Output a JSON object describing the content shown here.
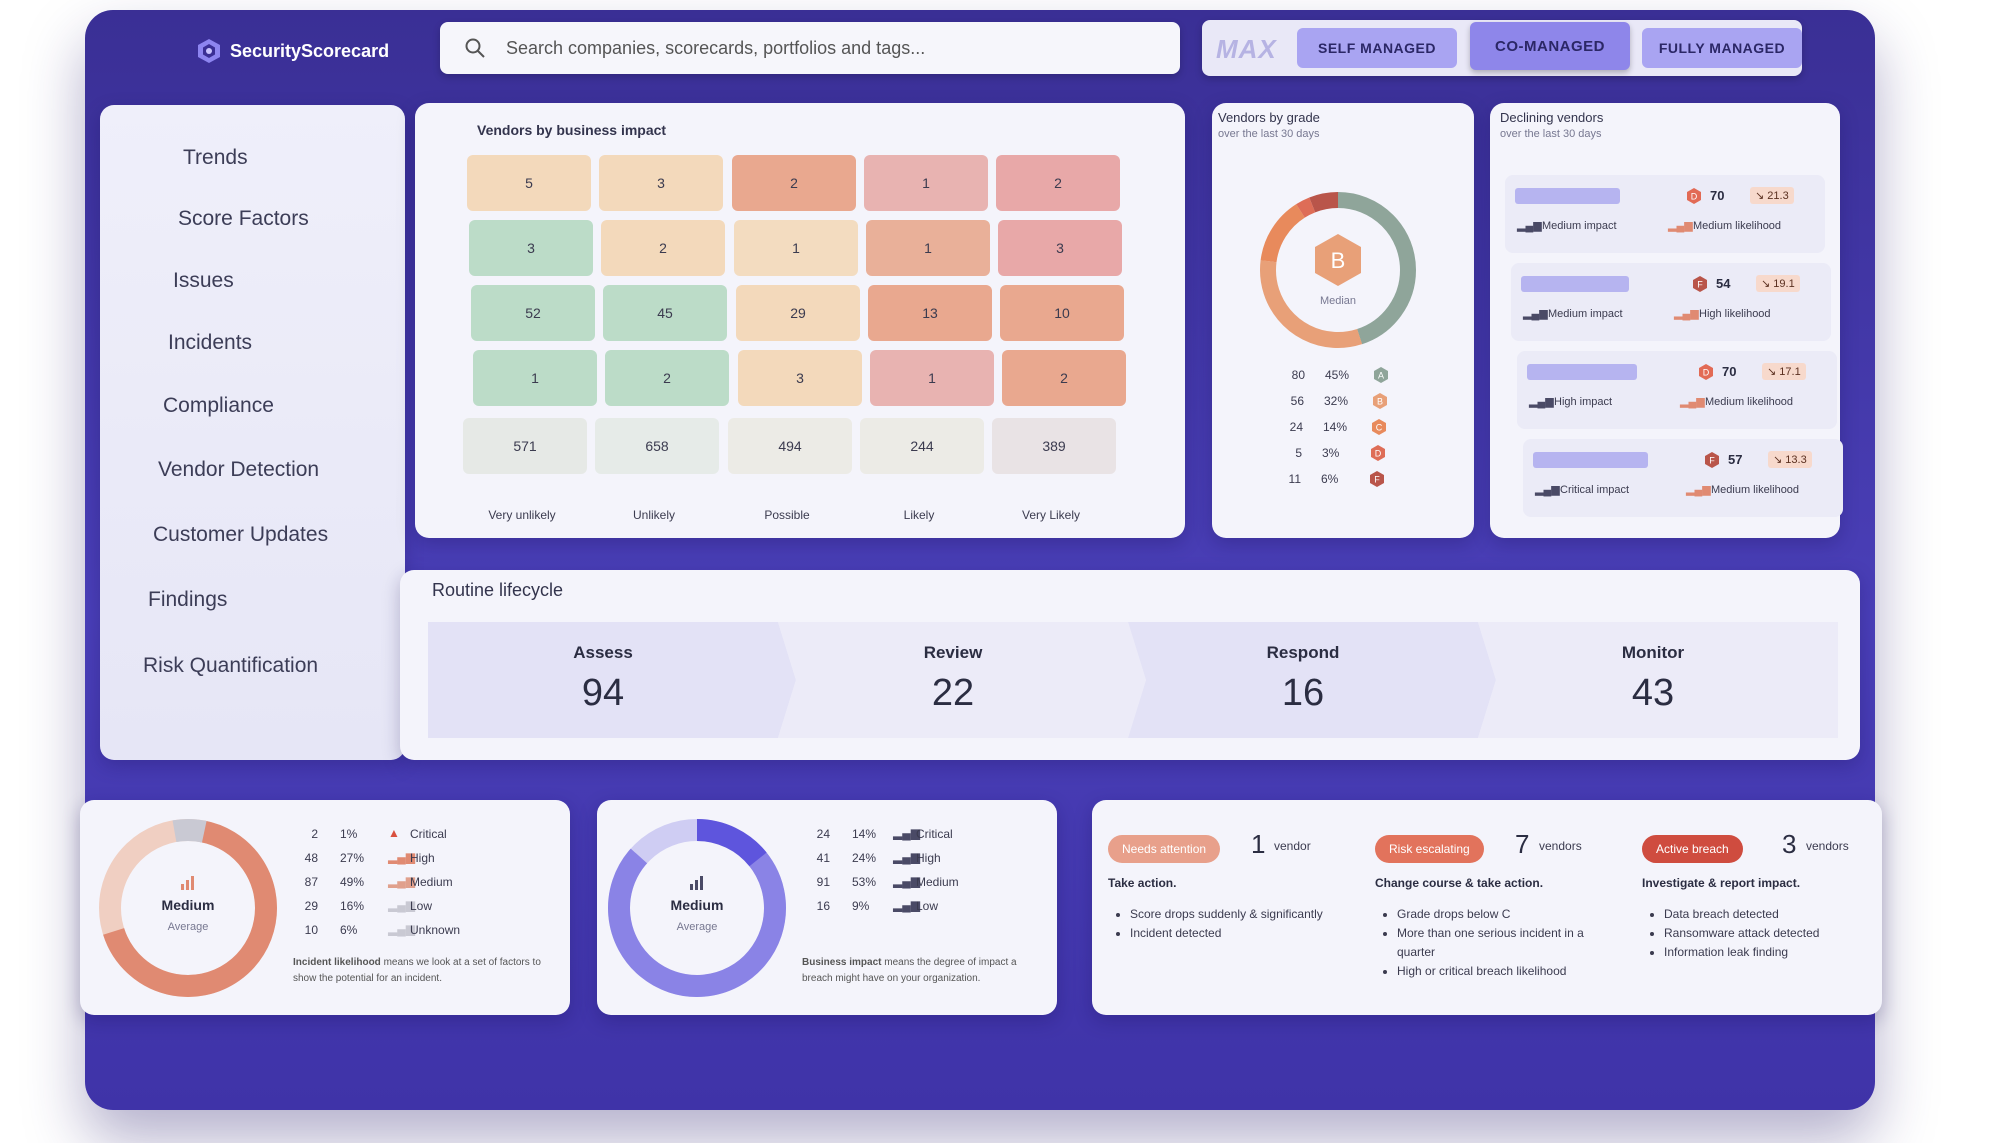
{
  "brand": {
    "name": "SecurityScorecard"
  },
  "search": {
    "placeholder": "Search companies, scorecards, portfolios and tags..."
  },
  "tiers": {
    "logo": "MAX",
    "items": [
      "SELF MANAGED",
      "CO-MANAGED",
      "FULLY MANAGED"
    ],
    "active": "CO-MANAGED"
  },
  "sidebar": {
    "items": [
      "Trends",
      "Score Factors",
      "Issues",
      "Incidents",
      "Compliance",
      "Vendor Detection",
      "Customer Updates",
      "Findings",
      "Risk Quantification"
    ]
  },
  "heatmap": {
    "title": "Vendors by business impact",
    "rows": [
      [
        "5",
        "3",
        "2",
        "1",
        "2"
      ],
      [
        "3",
        "2",
        "1",
        "1",
        "3"
      ],
      [
        "52",
        "45",
        "29",
        "13",
        "10"
      ],
      [
        "1",
        "2",
        "3",
        "1",
        "2"
      ]
    ],
    "colors": [
      [
        "#f3d9bb",
        "#f3d9bb",
        "#e9a88f",
        "#e8b3b1",
        "#e8a8a8"
      ],
      [
        "#bcdcc8",
        "#f3d9bb",
        "#f3dcc0",
        "#e9b099",
        "#e8a8a8"
      ],
      [
        "#bcdcc8",
        "#bcdcc8",
        "#f3d9bb",
        "#e9a88f",
        "#e9a88f"
      ],
      [
        "#bcdcc8",
        "#bcdcc8",
        "#f3d9bb",
        "#e8b3b1",
        "#e9a88f"
      ]
    ],
    "totals": [
      "571",
      "658",
      "494",
      "244",
      "389"
    ],
    "total_colors": [
      "#e6e9e6",
      "#e6ebe8",
      "#ecebe6",
      "#ecebe6",
      "#e9e3e5"
    ],
    "columns": [
      "Very unlikely",
      "Unlikely",
      "Possible",
      "Likely",
      "Very Likely"
    ]
  },
  "grade": {
    "title": "Vendors by grade",
    "subtitle": "over the last 30 days",
    "median_grade": "B",
    "median_label": "Median",
    "rows": [
      {
        "count": "80",
        "pct": "45%",
        "grade": "A",
        "color": "#8fa59a"
      },
      {
        "count": "56",
        "pct": "32%",
        "grade": "B",
        "color": "#e8a078"
      },
      {
        "count": "24",
        "pct": "14%",
        "grade": "C",
        "color": "#e88a5c"
      },
      {
        "count": "5",
        "pct": "3%",
        "grade": "D",
        "color": "#de6d57"
      },
      {
        "count": "11",
        "pct": "6%",
        "grade": "F",
        "color": "#b9554a"
      }
    ],
    "ring_share": [
      45,
      32,
      14,
      3,
      6
    ]
  },
  "declining": {
    "title": "Declining vendors",
    "subtitle": "over the last 30 days",
    "items": [
      {
        "grade": "D",
        "score": "70",
        "delta": "↘ 21.3",
        "impact": "Medium impact",
        "likelihood": "Medium likelihood",
        "grade_color": "#e26a55"
      },
      {
        "grade": "F",
        "score": "54",
        "delta": "↘ 19.1",
        "impact": "Medium impact",
        "likelihood": "High likelihood",
        "grade_color": "#b9554a"
      },
      {
        "grade": "D",
        "score": "70",
        "delta": "↘ 17.1",
        "impact": "High impact",
        "likelihood": "Medium likelihood",
        "grade_color": "#e26a55"
      },
      {
        "grade": "F",
        "score": "57",
        "delta": "↘ 13.3",
        "impact": "Critical impact",
        "likelihood": "Medium likelihood",
        "grade_color": "#b9554a"
      }
    ]
  },
  "lifecycle": {
    "title": "Routine lifecycle",
    "stages": [
      {
        "label": "Assess",
        "value": "94"
      },
      {
        "label": "Review",
        "value": "22"
      },
      {
        "label": "Respond",
        "value": "16"
      },
      {
        "label": "Monitor",
        "value": "43"
      }
    ]
  },
  "likelihood": {
    "center_label": "Medium",
    "center_sub": "Average",
    "rows": [
      {
        "count": "2",
        "pct": "1%",
        "label": "Critical"
      },
      {
        "count": "48",
        "pct": "27%",
        "label": "High"
      },
      {
        "count": "87",
        "pct": "49%",
        "label": "Medium"
      },
      {
        "count": "29",
        "pct": "16%",
        "label": "Low"
      },
      {
        "count": "10",
        "pct": "6%",
        "label": "Unknown"
      }
    ],
    "note_bold": "Incident likelihood",
    "note": "means we look at a set of factors to show the potential for an incident."
  },
  "impact": {
    "center_label": "Medium",
    "center_sub": "Average",
    "rows": [
      {
        "count": "24",
        "pct": "14%",
        "label": "Critical"
      },
      {
        "count": "41",
        "pct": "24%",
        "label": "High"
      },
      {
        "count": "91",
        "pct": "53%",
        "label": "Medium"
      },
      {
        "count": "16",
        "pct": "9%",
        "label": "Low"
      }
    ],
    "note_bold": "Business impact",
    "note": "means the degree of impact a breach might have on your organization."
  },
  "status": [
    {
      "pill": "Needs attention",
      "pill_color": "#e8a08b",
      "count": "1",
      "unit": "vendor",
      "head": "Take action.",
      "bullets": [
        "Score drops suddenly & significantly",
        "Incident detected"
      ]
    },
    {
      "pill": "Risk escalating",
      "pill_color": "#e2735c",
      "count": "7",
      "unit": "vendors",
      "head": "Change course & take action.",
      "bullets": [
        "Grade drops below C",
        "More than one serious incident in a quarter",
        "High or critical breach likelihood"
      ]
    },
    {
      "pill": "Active breach",
      "pill_color": "#cf4c3f",
      "count": "3",
      "unit": "vendors",
      "head": "Investigate & report impact.",
      "bullets": [
        "Data breach detected",
        "Ransomware attack detected",
        "Information leak finding"
      ]
    }
  ]
}
